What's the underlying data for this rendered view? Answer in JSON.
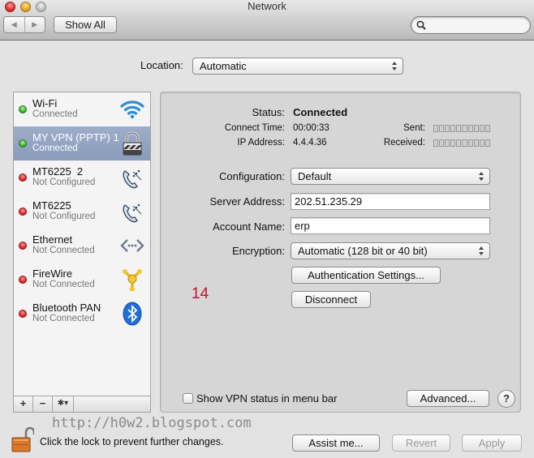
{
  "window": {
    "title": "Network",
    "show_all_label": "Show All",
    "search_placeholder": ""
  },
  "location": {
    "label": "Location:",
    "value": "Automatic"
  },
  "services": [
    {
      "name": "Wi-Fi",
      "status": "Connected",
      "status_color": "green",
      "icon": "wifi-icon",
      "selected": false
    },
    {
      "name": "MY VPN (PPTP) 1",
      "status": "Connected",
      "status_color": "green",
      "icon": "vpn-lock-icon",
      "selected": true
    },
    {
      "name": "MT6225  2",
      "status": "Not Configured",
      "status_color": "red",
      "icon": "phone-modem-icon",
      "selected": false
    },
    {
      "name": "MT6225",
      "status": "Not Configured",
      "status_color": "red",
      "icon": "phone-modem-icon",
      "selected": false
    },
    {
      "name": "Ethernet",
      "status": "Not Connected",
      "status_color": "red",
      "icon": "ethernet-icon",
      "selected": false
    },
    {
      "name": "FireWire",
      "status": "Not Connected",
      "status_color": "red",
      "icon": "firewire-icon",
      "selected": false
    },
    {
      "name": "Bluetooth PAN",
      "status": "Not Connected",
      "status_color": "red",
      "icon": "bluetooth-icon",
      "selected": false
    }
  ],
  "sidebar_buttons": {
    "add": "+",
    "remove": "−",
    "action": "✱▾"
  },
  "detail": {
    "status_label": "Status:",
    "status_value": "Connected",
    "connect_time_label": "Connect Time:",
    "connect_time_value": "00:00:33",
    "ip_label": "IP Address:",
    "ip_value": "4.4.4.36",
    "sent_label": "Sent:",
    "received_label": "Received:",
    "sent_level": 0,
    "received_level": 0,
    "configuration_label": "Configuration:",
    "configuration_value": "Default",
    "server_label": "Server Address:",
    "server_value": "202.51.235.29",
    "account_label": "Account Name:",
    "account_value": "erp",
    "encryption_label": "Encryption:",
    "encryption_value": "Automatic (128 bit or 40 bit)",
    "auth_button": "Authentication Settings...",
    "disconnect_button": "Disconnect",
    "annotation": "14",
    "show_vpn_label": "Show VPN status in menu bar",
    "show_vpn_checked": false,
    "advanced_button": "Advanced...",
    "help_button": "?"
  },
  "footer": {
    "watermark": "http://h0w2.blogspot.com",
    "lock_text": "Click the lock to prevent further changes.",
    "assist_button": "Assist me...",
    "revert_button": "Revert",
    "apply_button": "Apply"
  },
  "colors": {
    "selected_row": "#8e9fbf",
    "annotation": "#c0142a",
    "status_green": "#2ea41f",
    "status_red": "#d3171b"
  }
}
